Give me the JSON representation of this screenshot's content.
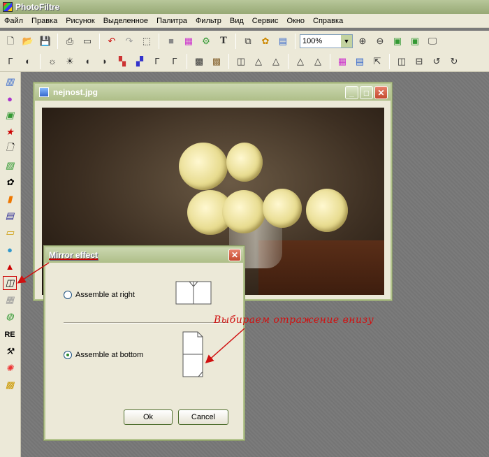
{
  "app": {
    "title": "PhotoFiltre"
  },
  "menu": [
    "Файл",
    "Правка",
    "Рисунок",
    "Выделенное",
    "Палитра",
    "Фильтр",
    "Вид",
    "Сервис",
    "Окно",
    "Справка"
  ],
  "toolbar": {
    "zoom_value": "100%"
  },
  "image_window": {
    "title": "nejnost.jpg"
  },
  "sidebar": {
    "re_label": "RE"
  },
  "dialog": {
    "title": "Mirror effect",
    "option_right": "Assemble at right",
    "option_bottom": "Assemble at bottom",
    "selected": "option_bottom",
    "ok_label": "Ok",
    "cancel_label": "Cancel"
  },
  "annotation": {
    "text": "Выбираем отражение внизу"
  },
  "colors": {
    "annotation": "#d01010",
    "title_bar": "#aebe88"
  }
}
